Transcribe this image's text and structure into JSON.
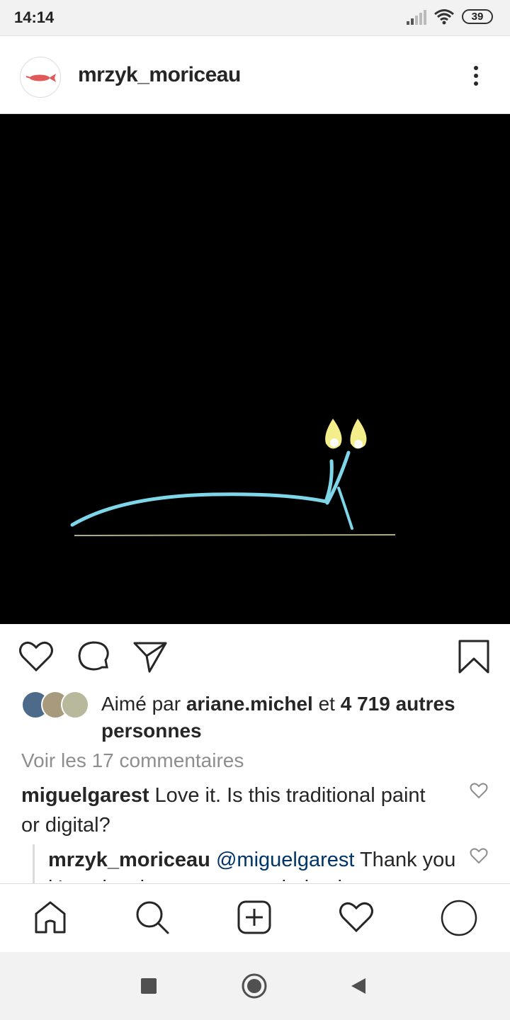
{
  "status_bar": {
    "time": "14:14",
    "battery": "39"
  },
  "post": {
    "username": "mrzyk_moriceau",
    "image_description": "",
    "likes": {
      "prefix": "Aimé par ",
      "first_liker": "ariane.michel",
      "middle": " et ",
      "others": "4 719 autres personnes"
    },
    "view_comments": "Voir les 17 commentaires",
    "comment": {
      "username": "miguelgarest",
      "text": " Love it. Is this traditional paint or digital?"
    },
    "reply": {
      "username": "mrzyk_moriceau",
      "mention": "@miguelgarest",
      "text": " Thank you it's a drawing on paper colorized on"
    }
  },
  "colors": {
    "text": "#262626",
    "muted": "#8e8e8e",
    "mention": "#003569",
    "image_bg": "#000000",
    "slug_body": "#7fd6e8",
    "flame": "#f3ee8a"
  }
}
